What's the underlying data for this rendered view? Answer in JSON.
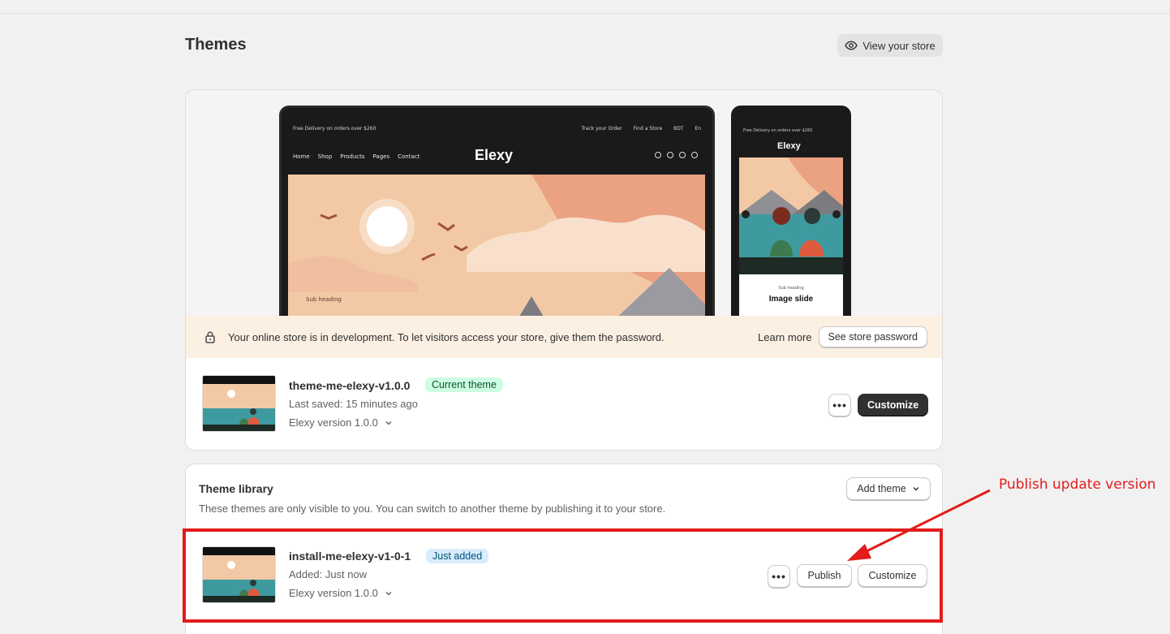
{
  "header": {
    "title": "Themes",
    "view_store_label": "View your store"
  },
  "preview": {
    "desktop": {
      "topbar_left": "Free Delivery on orders over $260",
      "topbar_right": [
        "Track your Order",
        "Find a Store",
        "BDT",
        "En"
      ],
      "nav": [
        "Home",
        "Shop",
        "Products",
        "Pages",
        "Contact"
      ],
      "logo": "Elexy",
      "sub_heading": "Sub heading"
    },
    "mobile": {
      "topbar": "Free Delivery on orders over $260",
      "logo": "Elexy",
      "sub_heading": "Sub heading",
      "slide_title": "Image slide"
    }
  },
  "dev_banner": {
    "message": "Your online store is in development. To let visitors access your store, give them the password.",
    "learn_more": "Learn more",
    "password_button": "See store password"
  },
  "current_theme": {
    "name": "theme-me-elexy-v1.0.0",
    "badge": "Current theme",
    "last_saved": "Last saved: 15 minutes ago",
    "version": "Elexy version 1.0.0",
    "customize_label": "Customize",
    "more_label": "•••"
  },
  "library": {
    "title": "Theme library",
    "description": "These themes are only visible to you. You can switch to another theme by publishing it to your store.",
    "add_theme_label": "Add theme",
    "themes": [
      {
        "name": "install-me-elexy-v1-0-1",
        "badge": "Just added",
        "added": "Added: Just now",
        "version": "Elexy version 1.0.0",
        "publish_label": "Publish",
        "customize_label": "Customize",
        "more_label": "•••"
      }
    ]
  },
  "annotation": {
    "text": "Publish update version",
    "color": "#e21b1b"
  }
}
